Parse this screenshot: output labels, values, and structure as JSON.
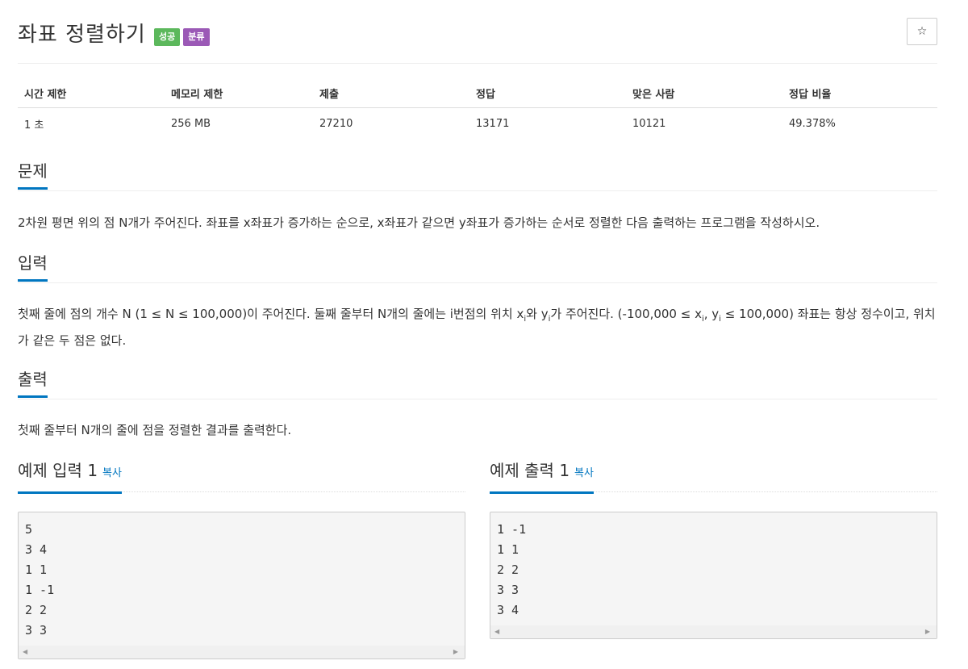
{
  "header": {
    "title": "좌표 정렬하기",
    "badge_success": "성공",
    "badge_category": "분류",
    "star_icon": "☆"
  },
  "info": {
    "headers": [
      "시간 제한",
      "메모리 제한",
      "제출",
      "정답",
      "맞은 사람",
      "정답 비율"
    ],
    "values": [
      "1 초",
      "256 MB",
      "27210",
      "13171",
      "10121",
      "49.378%"
    ]
  },
  "problem": {
    "heading": "문제",
    "text": "2차원 평면 위의 점 N개가 주어진다. 좌표를 x좌표가 증가하는 순으로, x좌표가 같으면 y좌표가 증가하는 순서로 정렬한 다음 출력하는 프로그램을 작성하시오."
  },
  "input": {
    "heading": "입력",
    "text_part1": "첫째 줄에 점의 개수 N (1 ≤ N ≤ 100,000)이 주어진다. 둘째 줄부터 N개의 줄에는 i번점의 위치 x",
    "sub_i1": "i",
    "text_part2": "와 y",
    "sub_i2": "i",
    "text_part3": "가 주어진다. (-100,000 ≤ x",
    "sub_i3": "i",
    "text_part4": ", y",
    "sub_i4": "i",
    "text_part5": " ≤ 100,000) 좌표는 항상 정수이고, 위치가 같은 두 점은 없다."
  },
  "output": {
    "heading": "출력",
    "text": "첫째 줄부터 N개의 줄에 점을 정렬한 결과를 출력한다."
  },
  "sample_input": {
    "heading": "예제 입력 1",
    "copy_label": "복사",
    "content": "5\n3 4\n1 1\n1 -1\n2 2\n3 3"
  },
  "sample_output": {
    "heading": "예제 출력 1",
    "copy_label": "복사",
    "content": "1 -1\n1 1\n2 2\n3 3\n3 4"
  },
  "colors": {
    "accent": "#0076c0",
    "success": "#5cb85c",
    "category": "#9b59b6"
  }
}
